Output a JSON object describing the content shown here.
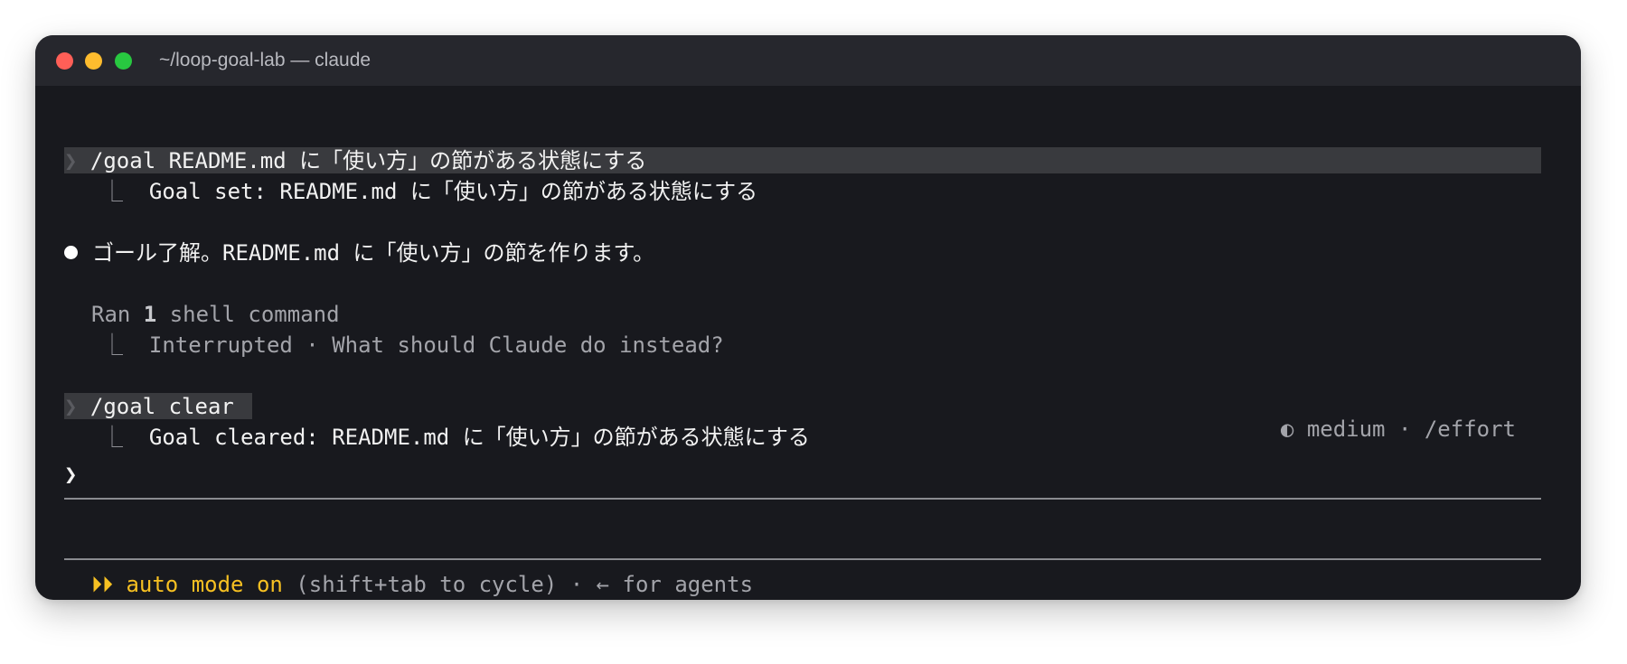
{
  "window": {
    "title": "~/loop-goal-lab — claude"
  },
  "transcript": {
    "cmd1": {
      "chevron": "❯",
      "text": "/goal README.md に「使い方」の節がある状態にする"
    },
    "result1": {
      "branch": "⎿",
      "text": "Goal set: README.md に「使い方」の節がある状態にする"
    },
    "assistant": {
      "text": "ゴール了解。README.md に「使い方」の節を作ります。"
    },
    "tool": {
      "prefix": "Ran ",
      "count": "1",
      "suffix": " shell command",
      "branch": "⎿",
      "detail": "Interrupted · What should Claude do instead?"
    },
    "cmd2": {
      "chevron": "❯",
      "text": "/goal clear"
    },
    "result2": {
      "branch": "⎿",
      "text": "Goal cleared: README.md に「使い方」の節がある状態にする"
    }
  },
  "effort": {
    "icon": "◐",
    "text": "medium · /effort"
  },
  "prompt": {
    "chevron": "❯",
    "value": ""
  },
  "footer": {
    "mode_icon": "⏵⏵",
    "mode_label": "auto mode on",
    "hint": "(shift+tab to cycle) · ← for agents"
  },
  "colors": {
    "background": "#18191e",
    "titlebar": "#26272d",
    "accent_yellow": "#f6c022",
    "highlight": "#393a3e"
  },
  "icons": [
    "close-icon",
    "minimize-icon",
    "maximize-icon",
    "prompt-chevron-icon",
    "branch-icon",
    "bullet-icon",
    "effort-half-circle-icon",
    "fast-forward-icon"
  ]
}
